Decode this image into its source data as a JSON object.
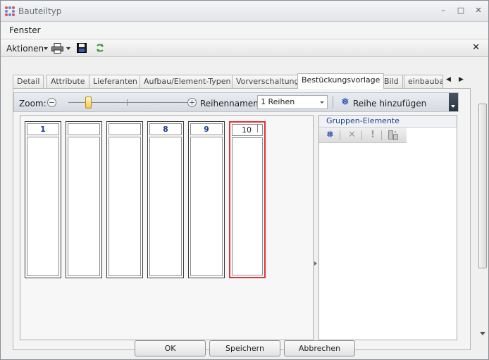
{
  "window": {
    "title": "Bauteiltyp",
    "controls": [
      "minimize-icon",
      "maximize-icon",
      "close-icon"
    ]
  },
  "menu": {
    "items": [
      "Fenster"
    ]
  },
  "toolbar": {
    "aktionen_label": "Aktionen",
    "icons": [
      "printer-icon",
      "save-icon",
      "refresh-icon"
    ]
  },
  "tabs": {
    "items": [
      "Detail",
      "Attribute",
      "Lieferanten",
      "Aufbau/Element-Typen",
      "Vorverschaltung",
      "Bestückungsvorlage",
      "Bild",
      "einbaubar"
    ],
    "active": "Bestückungsvorlage"
  },
  "zoombar": {
    "zoom_label": "Zoom:",
    "reihennamen_label": "Reihennamen:",
    "reihennamen_value": "1 Reihen",
    "add_row_label": "Reihe hinzufügen"
  },
  "rows": {
    "columns": [
      {
        "header": "1"
      },
      {
        "header": ""
      },
      {
        "header": ""
      },
      {
        "header": "8"
      },
      {
        "header": "9"
      },
      {
        "header": "10",
        "editing": true
      }
    ]
  },
  "gruppen": {
    "title": "Gruppen-Elemente",
    "tools": [
      "add-icon",
      "delete-icon",
      "exclamation-icon",
      "move-icon"
    ]
  },
  "buttons": {
    "ok": "OK",
    "speichern": "Speichern",
    "abbrechen": "Abbrechen"
  },
  "colors": {
    "accent_blue": "#1d3f8f",
    "edit_border": "#e0343a",
    "slider_thumb": "#f1c948"
  }
}
